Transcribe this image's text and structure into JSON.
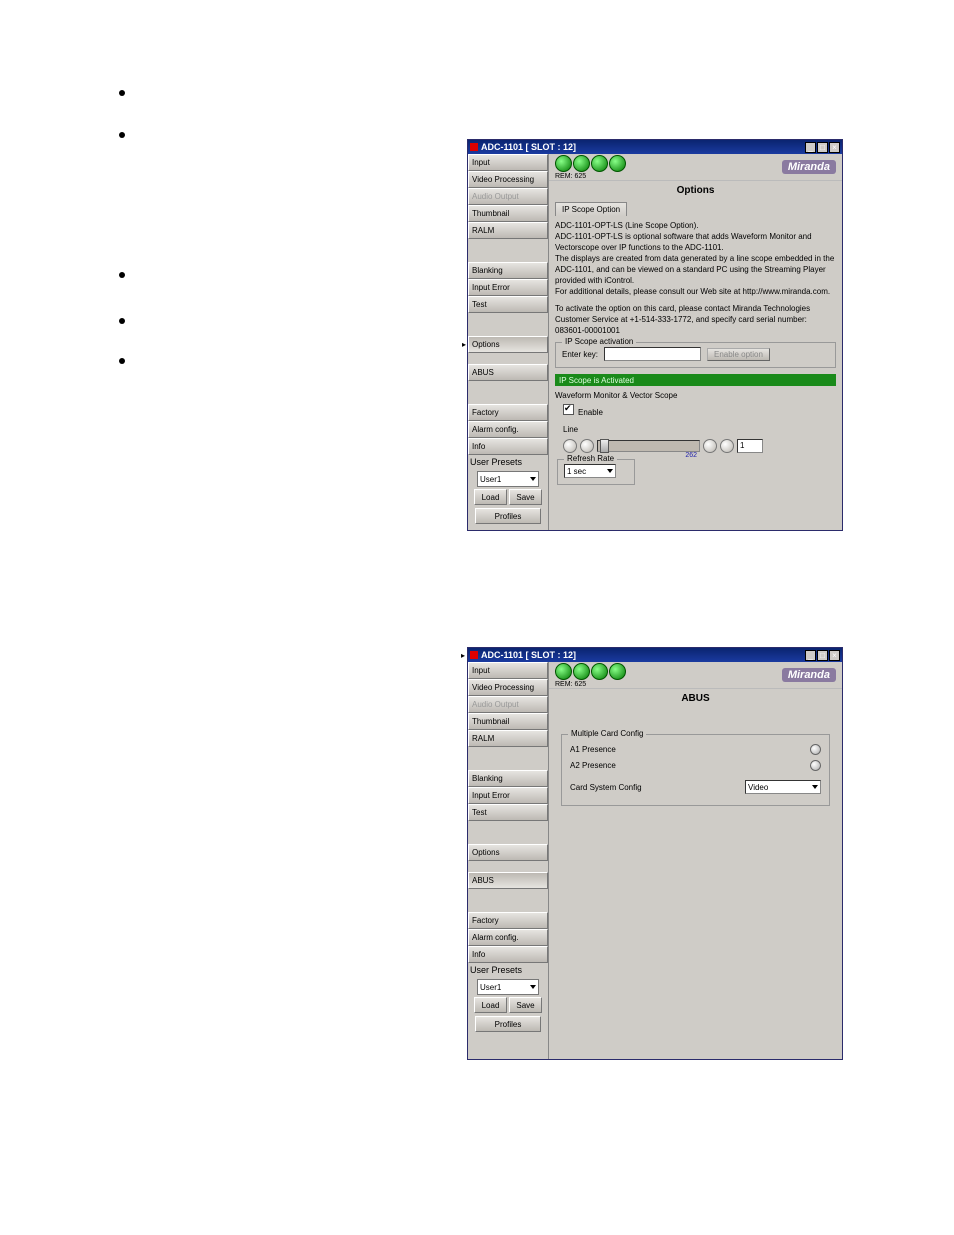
{
  "title": "ADC-1101 [ SLOT : 12]",
  "hdr_sub": "REM: 625",
  "brand": "Miranda",
  "sidebar": {
    "items": [
      "Input",
      "Video Processing",
      "Audio Output",
      "Thumbnail",
      "RALM",
      "Blanking",
      "Input Error",
      "Test",
      "Options",
      "ABUS",
      "Factory",
      "Alarm config.",
      "Info"
    ],
    "presets_header": "User Presets",
    "preset_sel": "User1",
    "load": "Load",
    "save": "Save",
    "profiles": "Profiles"
  },
  "options": {
    "pane_title": "Options",
    "tab": "IP Scope Option",
    "p1": "ADC-1101-OPT-LS (Line Scope Option).",
    "p2": "ADC-1101-OPT-LS is optional software that adds Waveform Monitor and Vectorscope over IP functions to the ADC-1101.",
    "p3": "The displays are created from data generated by a line scope embedded in the ADC-1101, and can be viewed on a standard PC using the Streaming Player provided with iControl.",
    "p4": "For additional details, please consult our Web site at http://www.miranda.com.",
    "p5": "To activate the option on this card, please contact Miranda Technologies Customer Service at +1-514-333-1772, and specify card serial number: 083601-00001001",
    "act_legend": "IP Scope activation",
    "enter_key": "Enter key:",
    "enable_btn": "Enable option",
    "activated": "IP Scope is Activated",
    "wv_label": "Waveform Monitor & Vector Scope",
    "enable_chk": "Enable",
    "line_label": "Line",
    "line_max": "262",
    "line_val": "1",
    "refresh_legend": "Refresh Rate",
    "refresh_val": "1 sec"
  },
  "abus": {
    "pane_title": "ABUS",
    "legend": "Multiple Card Config",
    "a1": "A1 Presence",
    "a2": "A2 Presence",
    "csc": "Card System Config",
    "csc_val": "Video"
  }
}
